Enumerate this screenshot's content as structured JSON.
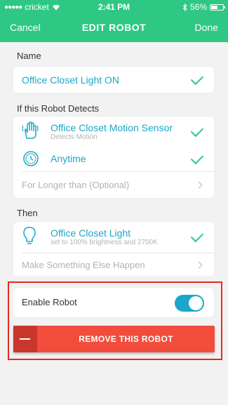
{
  "status": {
    "carrier": "cricket",
    "time": "2:41 PM",
    "battery": "56%",
    "battery_level": 0.56
  },
  "nav": {
    "cancel": "Cancel",
    "title": "EDIT ROBOT",
    "done": "Done"
  },
  "name_section": {
    "label": "Name",
    "value": "Office Closet Light ON"
  },
  "detects_section": {
    "label": "If this Robot Detects",
    "items": [
      {
        "title": "Office Closet Motion Sensor",
        "subtitle": "Detects Motion",
        "icon": "motion-hand-icon"
      },
      {
        "title": "Anytime",
        "icon": "clock-icon"
      }
    ],
    "duration_placeholder": "For Longer than (Optional)"
  },
  "then_section": {
    "label": "Then",
    "item": {
      "title": "Office Closet Light",
      "subtitle": "set to 100% brightness and 2700K",
      "icon": "lightbulb-icon"
    },
    "more": "Make Something Else Happen"
  },
  "enable": {
    "label": "Enable Robot",
    "on": true
  },
  "remove": {
    "label": "REMOVE THIS ROBOT"
  },
  "colors": {
    "green": "#2ec884",
    "teal": "#1ba7c9",
    "red": "#f24c3d",
    "highlight": "#e42b1e"
  }
}
